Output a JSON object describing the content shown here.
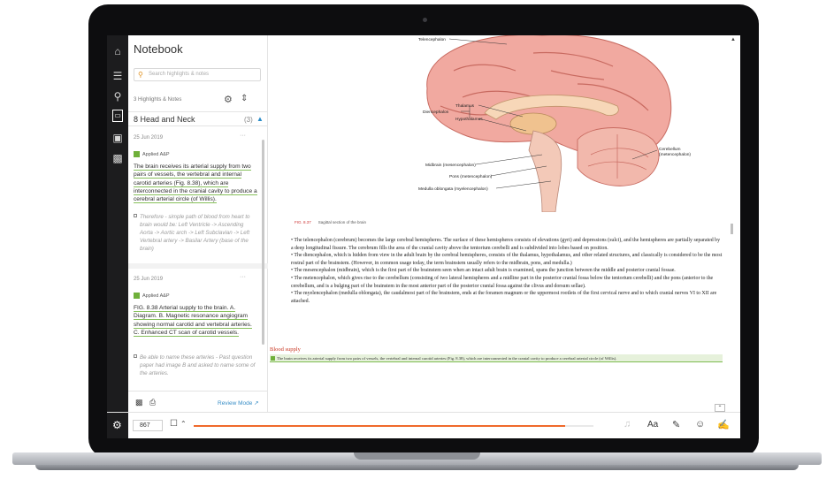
{
  "notebook": {
    "title": "Notebook",
    "search_placeholder": "Search highlights & notes",
    "count_label": "3 Highlights & Notes",
    "chapter_title": "8 Head and Neck",
    "chapter_count": "(3)",
    "cards": [
      {
        "date": "25 Jun 2019",
        "more": "···",
        "badge": "Applied A&P",
        "highlight": "The brain receives its arterial supply from two pairs of vessels, the vertebral and internal carotid arteries (Fig. 8.38), which are interconnected in the cranial cavity to produce a cerebral arterial circle (of Willis).",
        "note": "Therefore - simple path of blood from heart to brain would be: Left Ventricle -> Ascending Aorta -> Aortic arch -> Left Subclavian -> Left Vertebral artery -> Basilar Artery (base of the brain)"
      },
      {
        "date": "25 Jun 2019",
        "more": "···",
        "badge": "Applied A&P",
        "highlight": "FIG. 8.38 Arterial supply to the brain. A. Diagram. B. Magnetic resonance angiogram showing normal carotid and vertebral arteries. C. Enhanced CT scan of carotid vessels.",
        "note": "Be able to name these arteries - Past question paper had image B and asked to name some of the arteries."
      }
    ],
    "review_mode": "Review Mode ↗"
  },
  "bottombar": {
    "page": "867",
    "progress_fraction": 0.93,
    "font_label": "Aa"
  },
  "reader": {
    "figure_labels": {
      "top": "Telencephalon",
      "thalamus": "Thalamus",
      "diencephalon": "Diencephalon",
      "hypothalamus": "Hypothalamus",
      "midbrain": "Midbrain (mesencephalon)",
      "pons": "Pons (metencephalon)",
      "medulla": "Medulla oblongata (myelencephalon)",
      "cerebellum": "Cerebellum",
      "cerebellum2": "(metencephalon)"
    },
    "caption_num": "FIG. 8.37",
    "caption_text": "Sagittal section of the brain",
    "paragraphs": [
      "• The telencephalon (cerebrum) becomes the large cerebral hemispheres. The surface of these hemispheres consists of elevations (gyri) and depressions (sulci), and the hemispheres are partially separated by a deep longitudinal fissure. The cerebrum fills the area of the cranial cavity above the tentorium cerebelli and is subdivided into lobes based on position.",
      "• The diencephalon, which is hidden from view in the adult brain by the cerebral hemispheres, consists of the thalamus, hypothalamus, and other related structures, and classically is considered to be the most rostral part of the brainstem. (However, in common usage today, the term brainstem usually refers to the midbrain, pons, and medulla.)",
      "• The mesencephalon (midbrain), which is the first part of the brainstem seen when an intact adult brain is examined, spans the junction between the middle and posterior cranial fossae.",
      "• The metencephalon, which gives rise to the cerebellum (consisting of two lateral hemispheres and a midline part in the posterior cranial fossa below the tentorium cerebelli) and the pons (anterior to the cerebellum, and is a bulging part of the brainstem in the most anterior part of the posterior cranial fossa against the clivus and dorsum sellae).",
      "• The myelencephalon (medulla oblongata), the caudalmost part of the brainstem, ends at the foramen magnum or the uppermost rootlets of the first cervical nerve and to which cranial nerves VI to XII are attached."
    ],
    "subheading": "Blood supply",
    "highlighted_line": "The brain receives its arterial supply from two pairs of vessels, the vertebral and internal carotid arteries (Fig. 8.38), which are interconnected in the cranial cavity to produce a cerebral arterial circle (of Willis)."
  },
  "colors": {
    "accent_orange": "#ef6a2b",
    "highlight_green": "#6fb03a",
    "link_blue": "#3a8fc7",
    "rail": "#1c1c1e",
    "subheading_red": "#c8341f"
  },
  "icons": [
    "home-icon",
    "toc-icon",
    "search-icon",
    "notebook-icon",
    "image-icon",
    "flashcard-icon",
    "settings-icon",
    "bookmark-icon",
    "font-icon",
    "highlighter-icon",
    "help-icon",
    "edit-icon",
    "print-icon",
    "gear-icon",
    "filter-icon"
  ]
}
